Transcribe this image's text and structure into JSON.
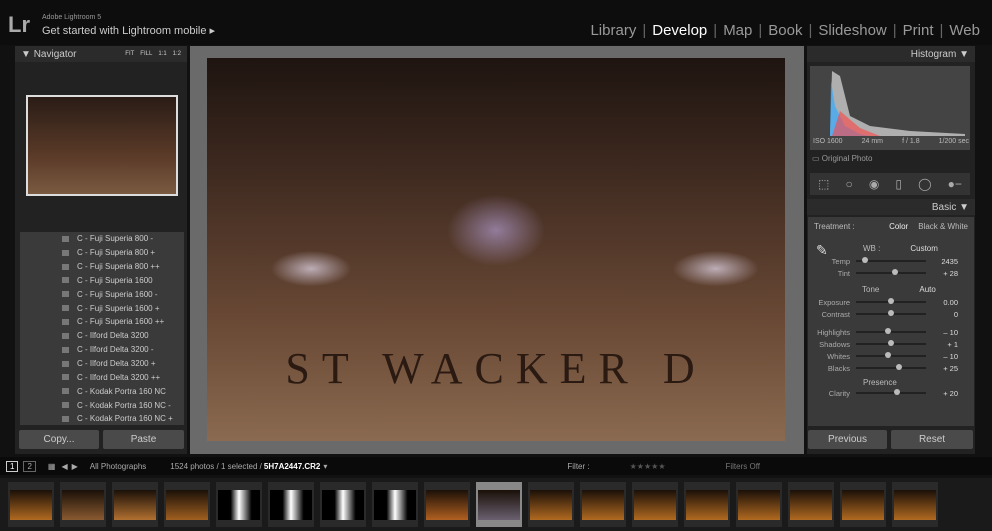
{
  "app": {
    "logo": "Lr",
    "version": "Adobe Lightroom 5",
    "mobile": "Get started with Lightroom mobile"
  },
  "modules": [
    "Library",
    "Develop",
    "Map",
    "Book",
    "Slideshow",
    "Print",
    "Web"
  ],
  "active_module": "Develop",
  "navigator": {
    "title": "Navigator",
    "zoom": [
      "FIT",
      "FILL",
      "1:1",
      "1:2"
    ]
  },
  "presets": [
    "C - Fuji Superia 800 -",
    "C - Fuji Superia 800 +",
    "C - Fuji Superia 800 ++",
    "C - Fuji Superia 1600",
    "C - Fuji Superia 1600 -",
    "C - Fuji Superia 1600 +",
    "C - Fuji Superia 1600 ++",
    "C - Ilford Delta 3200",
    "C - Ilford Delta 3200 -",
    "C - Ilford Delta 3200 +",
    "C - Ilford Delta 3200 ++",
    "C - Kodak Portra 160 NC",
    "C - Kodak Portra 160 NC -",
    "C - Kodak Portra 160 NC +"
  ],
  "left_buttons": {
    "copy": "Copy...",
    "paste": "Paste"
  },
  "photo": {
    "text": "ST WACKER D"
  },
  "histogram": {
    "title": "Histogram",
    "iso": "ISO 1600",
    "focal": "24 mm",
    "aperture": "f / 1.8",
    "shutter": "1/200 sec",
    "original": "Original Photo"
  },
  "basic": {
    "title": "Basic",
    "treatment_label": "Treatment :",
    "color": "Color",
    "bw": "Black & White",
    "wb_label": "WB :",
    "wb_value": "Custom",
    "tone": "Tone",
    "auto": "Auto",
    "presence": "Presence",
    "sliders": [
      {
        "label": "Temp",
        "value": "2435",
        "pos": 0.1
      },
      {
        "label": "Tint",
        "value": "+ 28",
        "pos": 0.57
      },
      {
        "label": "Exposure",
        "value": "0.00",
        "pos": 0.5
      },
      {
        "label": "Contrast",
        "value": "0",
        "pos": 0.5
      },
      {
        "label": "Highlights",
        "value": "– 10",
        "pos": 0.45
      },
      {
        "label": "Shadows",
        "value": "+ 1",
        "pos": 0.5
      },
      {
        "label": "Whites",
        "value": "– 10",
        "pos": 0.45
      },
      {
        "label": "Blacks",
        "value": "+ 25",
        "pos": 0.62
      },
      {
        "label": "Clarity",
        "value": "+ 20",
        "pos": 0.6
      }
    ]
  },
  "right_buttons": {
    "previous": "Previous",
    "reset": "Reset"
  },
  "toolbar": {
    "page1": "1",
    "page2": "2",
    "source": "All Photographs",
    "count": "1524 photos / 1 selected /",
    "filename": "5H7A2447.CR2",
    "filter": "Filter :",
    "filter_value": "Filters Off"
  },
  "filmstrip": [
    "#b06a20",
    "#8a5a30",
    "#b07030",
    "#a06020",
    "#ffffff",
    "#ffffff",
    "#ffffff",
    "#ffffff",
    "#b06020",
    "#6a6070",
    "#b06a20",
    "#b06a20",
    "#b06a20",
    "#b06a20",
    "#b06a20",
    "#b06a20",
    "#b06a20",
    "#b06a20"
  ]
}
